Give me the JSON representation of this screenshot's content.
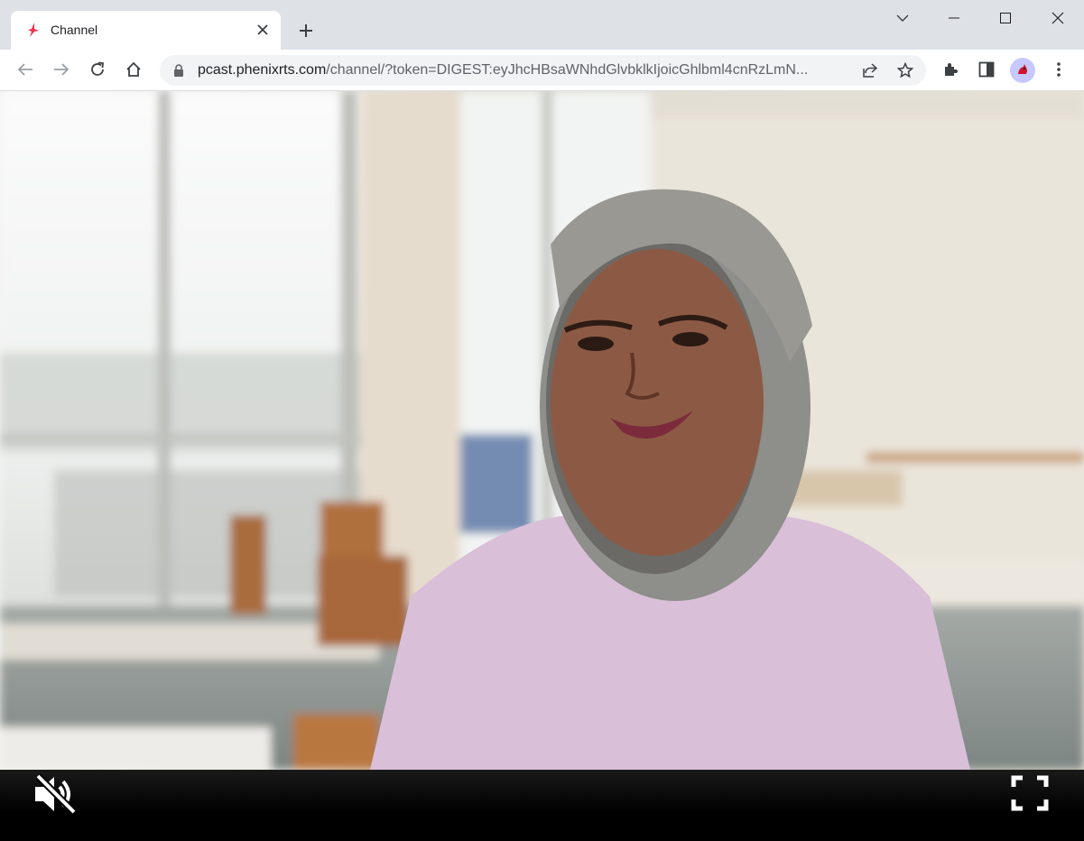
{
  "browser": {
    "tab": {
      "title": "Channel",
      "favicon": "phenix-bird-icon"
    },
    "new_tab_icon": "plus-icon",
    "window_controls": [
      "chevron-down-icon",
      "minimize-icon",
      "maximize-icon",
      "close-icon"
    ],
    "toolbar": {
      "url_host": "pcast.phenixrts.com",
      "url_rest": "/channel/?token=DIGEST:eyJhcHBsaWNhdGlvbklkIjoicGhlbml4cnRzLmN...",
      "icons": [
        "back-arrow-icon",
        "forward-arrow-icon",
        "reload-icon",
        "home-icon",
        "lock-icon",
        "share-icon",
        "star-icon",
        "extensions-icon",
        "side-panel-icon",
        "profile-avatar",
        "kebab-menu-icon"
      ]
    }
  },
  "player": {
    "content": "video frame: smiling woman with shoulder-length gray bob in lavender top, seated in a bright office room with tall windows and wooden chairs",
    "muted": true,
    "controls": [
      "muted-speaker-icon",
      "fullscreen-icon"
    ]
  }
}
